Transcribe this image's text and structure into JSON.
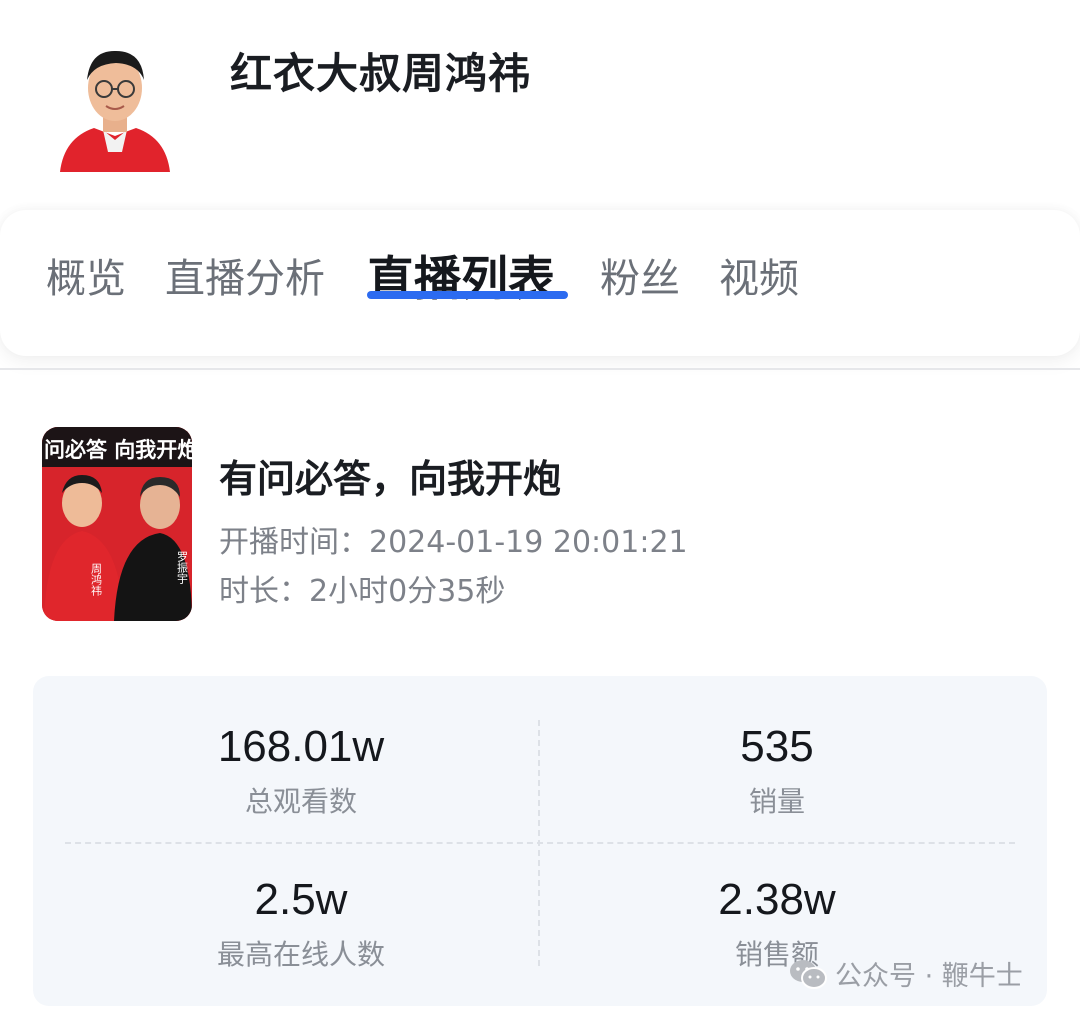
{
  "profile": {
    "name": "红衣大叔周鸿祎"
  },
  "tabs": [
    {
      "label": "概览"
    },
    {
      "label": "直播分析"
    },
    {
      "label": "直播列表"
    },
    {
      "label": "粉丝"
    },
    {
      "label": "视频"
    }
  ],
  "active_tab": "直播列表",
  "live": {
    "thumb_banner": "问必答 向我开炮",
    "thumb_person_left": "周鸿祎",
    "thumb_person_right": "罗振宇",
    "title": "有问必答，向我开炮",
    "start_label": "开播时间：",
    "start_value": "2024-01-19 20:01:21",
    "duration_label": "时长：",
    "duration_value": "2小时0分35秒"
  },
  "stats": [
    {
      "value": "168.01w",
      "label": "总观看数"
    },
    {
      "value": "535",
      "label": "销量"
    },
    {
      "value": "2.5w",
      "label": "最高在线人数"
    },
    {
      "value": "2.38w",
      "label": "销售额"
    }
  ],
  "watermark": {
    "text": "公众号 · 鞭牛士",
    "icon": "wechat-icon"
  },
  "colors": {
    "accent": "#2c6bf0",
    "brand_red": "#d8252c",
    "stats_bg": "#f4f7fb"
  }
}
